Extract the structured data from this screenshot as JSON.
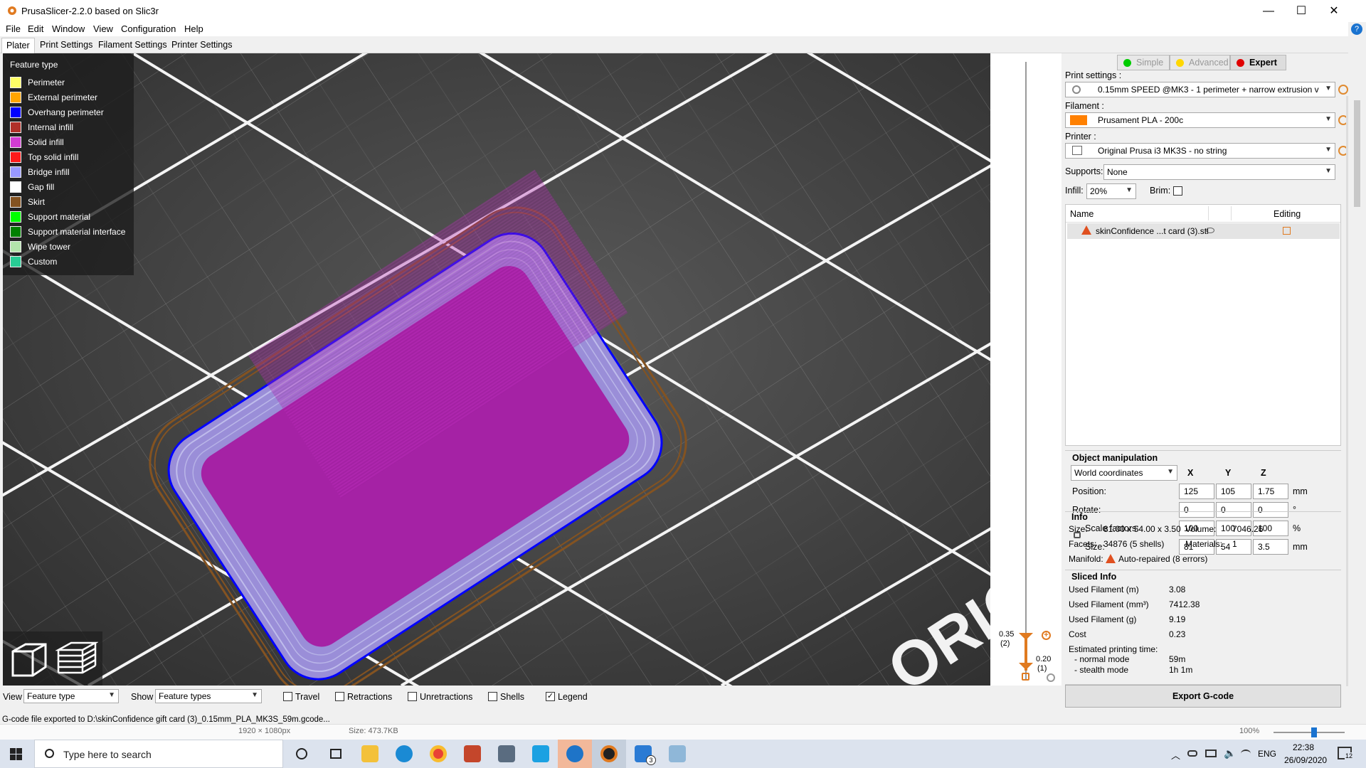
{
  "window": {
    "title": "PrusaSlicer-2.2.0 based on Slic3r",
    "minimize": "—",
    "maximize": "☐",
    "close": "✕"
  },
  "menu": [
    "File",
    "Edit",
    "Window",
    "View",
    "Configuration",
    "Help"
  ],
  "tabs": [
    "Plater",
    "Print Settings",
    "Filament Settings",
    "Printer Settings"
  ],
  "legend": {
    "title": "Feature type",
    "items": [
      {
        "label": "Perimeter",
        "color": "#ffff66"
      },
      {
        "label": "External perimeter",
        "color": "#ffa500"
      },
      {
        "label": "Overhang perimeter",
        "color": "#0000ff"
      },
      {
        "label": "Internal infill",
        "color": "#b03029"
      },
      {
        "label": "Solid infill",
        "color": "#d23cd2"
      },
      {
        "label": "Top solid infill",
        "color": "#ff1a1a"
      },
      {
        "label": "Bridge infill",
        "color": "#9999ff"
      },
      {
        "label": "Gap fill",
        "color": "#ffffff"
      },
      {
        "label": "Skirt",
        "color": "#845321"
      },
      {
        "label": "Support material",
        "color": "#00ff00"
      },
      {
        "label": "Support material interface",
        "color": "#008000"
      },
      {
        "label": "Wipe tower",
        "color": "#b3e3ab"
      },
      {
        "label": "Custom",
        "color": "#28cc94"
      }
    ]
  },
  "bed_text": "ORIG",
  "layer_slider": {
    "top_value": "0.35",
    "top_index": "(2)",
    "bottom_value": "0.20",
    "bottom_index": "(1)"
  },
  "modes": [
    {
      "label": "Simple",
      "color": "#00cc00",
      "active": false
    },
    {
      "label": "Advanced",
      "color": "#ffd700",
      "active": false
    },
    {
      "label": "Expert",
      "color": "#e00000",
      "active": true
    }
  ],
  "print_settings": {
    "label": "Print settings :",
    "value": "0.15mm SPEED @MK3 - 1 perimeter + narrow extrusion v"
  },
  "filament": {
    "label": "Filament :",
    "value": "Prusament PLA - 200c",
    "color": "#ff8000"
  },
  "printer": {
    "label": "Printer :",
    "value": "Original Prusa i3 MK3S - no string"
  },
  "supports": {
    "label": "Supports:",
    "value": "None"
  },
  "infill": {
    "label": "Infill:",
    "value": "20%"
  },
  "brim": {
    "label": "Brim:"
  },
  "object_list": {
    "col_name": "Name",
    "col_editing": "Editing",
    "items": [
      {
        "name": "skinConfidence ...t card (3).stl"
      }
    ]
  },
  "object_manipulation": {
    "title": "Object manipulation",
    "coords": "World coordinates",
    "axes": [
      "X",
      "Y",
      "Z"
    ],
    "rows": [
      {
        "label": "Position:",
        "values": [
          "125",
          "105",
          "1.75"
        ],
        "unit": "mm"
      },
      {
        "label": "Rotate:",
        "values": [
          "0",
          "0",
          "0"
        ],
        "unit": "°"
      },
      {
        "label": "Scale factors:",
        "values": [
          "100",
          "100",
          "100"
        ],
        "unit": "%"
      },
      {
        "label": "Size:",
        "values": [
          "81",
          "54",
          "3.5"
        ],
        "unit": "mm"
      }
    ]
  },
  "info": {
    "title": "Info",
    "size_label": "Size:",
    "size": "81.00 x 54.00 x 3.50",
    "volume_label": "Volume:",
    "volume": "7046.26",
    "facets_label": "Facets:",
    "facets": "34876 (5 shells)",
    "materials_label": "Materials:",
    "materials": "1",
    "manifold_label": "Manifold:",
    "manifold": "Auto-repaired (8 errors)"
  },
  "sliced_info": {
    "title": "Sliced Info",
    "rows": [
      {
        "label": "Used Filament (m)",
        "value": "3.08"
      },
      {
        "label": "Used Filament (mm³)",
        "value": "7412.38"
      },
      {
        "label": "Used Filament (g)",
        "value": "9.19"
      },
      {
        "label": "Cost",
        "value": "0.23"
      }
    ],
    "time_label": "Estimated printing time:",
    "normal_label": "- normal mode",
    "normal": "59m",
    "stealth_label": "- stealth mode",
    "stealth": "1h 1m"
  },
  "export_button": "Export G-code",
  "bottom": {
    "view_label": "View",
    "view_value": "Feature type",
    "show_label": "Show",
    "show_value": "Feature types",
    "checks": [
      {
        "label": "Travel",
        "checked": false
      },
      {
        "label": "Retractions",
        "checked": false
      },
      {
        "label": "Unretractions",
        "checked": false
      },
      {
        "label": "Shells",
        "checked": false
      },
      {
        "label": "Legend",
        "checked": true
      }
    ]
  },
  "status": "G-code file exported to D:\\skinConfidence gift card (3)_0.15mm_PLA_MK3S_59m.gcode...",
  "explorer": {
    "dims": "1920 × 1080px",
    "size": "Size: 473.7KB",
    "zoom": "100%"
  },
  "taskbar": {
    "search_placeholder": "Type here to search",
    "lang": "ENG",
    "time": "22:38",
    "date": "26/09/2020",
    "notif": "12",
    "mail_badge": "3"
  }
}
